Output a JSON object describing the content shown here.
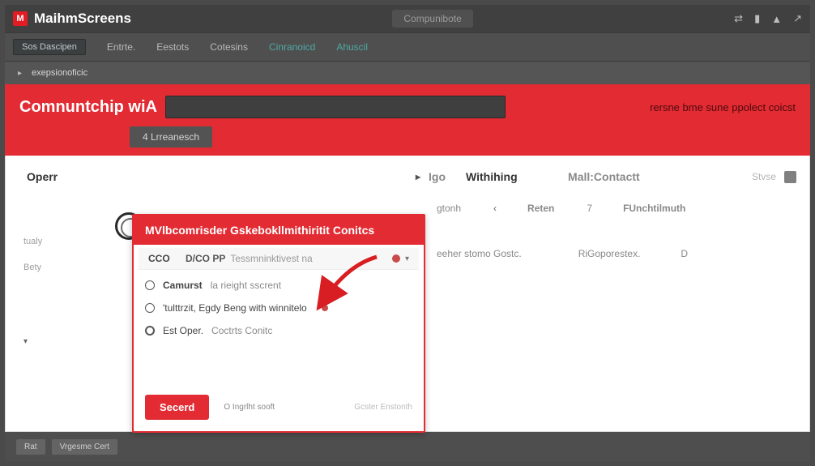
{
  "titlebar": {
    "logo_letter": "M",
    "app_name": "MaihmScreens",
    "center_tab": "Compunibote"
  },
  "nav": {
    "first": "Sos Dascipen",
    "items": [
      "Entrte.",
      "Eestots",
      "Cotesins"
    ],
    "teal_items": [
      "Cinranoicd",
      "Ahuscil"
    ]
  },
  "breadcrumb": {
    "text": "exepsionoficic"
  },
  "red_band": {
    "title": "Comnuntchip wiA",
    "note": "rersne bme sune ppolect coicst",
    "chip": "4 Lrreanesch"
  },
  "columns": {
    "c1": "Operr",
    "igo": "Igo",
    "withhing": "Withihing",
    "mailcontact": "Mall:Contactt",
    "state": "Stvse"
  },
  "row1": {
    "a": "gtonh",
    "b_angle": "‹",
    "b": "Reten",
    "c_num": "7",
    "c": "FUnchtilmuth"
  },
  "row2": {
    "a": "eeher stomo Gostc.",
    "b": "RiGoporestex.",
    "c": "D"
  },
  "side_left": {
    "r1": "tualy",
    "r2": "Bety"
  },
  "footer": {
    "b1": "Rat",
    "b2": "Vrgesme Cert"
  },
  "modal": {
    "header": "MVlbcomrisder Gskebokllmithiritit Conitcs",
    "field": {
      "label": "CCO",
      "tag": "D/CO PP",
      "placeholder": "Tessmninktivest na"
    },
    "options": [
      {
        "label": "Camurst",
        "sub": "la rieight sscrent",
        "dot": true
      },
      {
        "label": "'tulttrzit,  Egdy Beng with winnitelo",
        "sub": "",
        "dot": false
      },
      {
        "label": "Est Oper.",
        "sub": "Coctrts Conitc",
        "dot": false,
        "thick": true
      }
    ],
    "primary": "Secerd",
    "hint": "O  Ingrlht sooft",
    "hint_right": "Gcster Enstonth"
  }
}
